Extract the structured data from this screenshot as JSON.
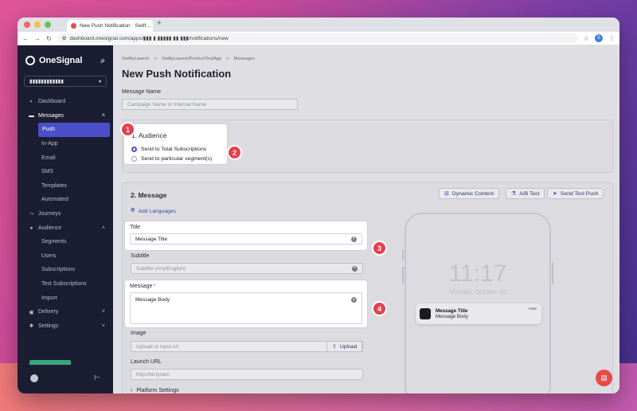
{
  "browser": {
    "tab_title": "New Push Notification · Swift…",
    "tab_close": "×",
    "new_tab": "+",
    "url": "dashboard.onesignal.com/apps/▮▮▮ ▮ ▮▮▮▮▮ ▮▮ ▮▮▮/notifications/new",
    "profile_initial": "S"
  },
  "sidebar": {
    "brand": "OneSignal",
    "app_selector": "▮▮▮▮▮▮▮▮▮▮▮▮",
    "items": [
      {
        "label": "Dashboard",
        "icon": "dashboard-icon"
      },
      {
        "label": "Messages",
        "icon": "messages-icon"
      },
      {
        "label": "Push"
      },
      {
        "label": "In-App"
      },
      {
        "label": "Email"
      },
      {
        "label": "SMS"
      },
      {
        "label": "Templates"
      },
      {
        "label": "Automated"
      },
      {
        "label": "Journeys",
        "icon": "journeys-icon"
      },
      {
        "label": "Audience",
        "icon": "audience-icon"
      },
      {
        "label": "Segments"
      },
      {
        "label": "Users"
      },
      {
        "label": "Subscriptions"
      },
      {
        "label": "Test Subscriptions"
      },
      {
        "label": "Import"
      },
      {
        "label": "Delivery",
        "icon": "delivery-icon"
      },
      {
        "label": "Settings",
        "icon": "settings-icon"
      }
    ]
  },
  "breadcrumb": [
    "SwiftyLaunch",
    "SwiftyLaunchProductTestApp",
    "Messages"
  ],
  "breadcrumb_sep": ">",
  "page_title": "New Push Notification",
  "message_name": {
    "label": "Message Name",
    "placeholder": "Campaign Name or Internal Name"
  },
  "audience": {
    "title": "1. Audience",
    "options": [
      "Send to Total Subscriptions",
      "Send to particular segment(s)"
    ],
    "selected_index": 0
  },
  "message": {
    "title": "2. Message",
    "buttons": {
      "dynamic_content": "Dynamic Content",
      "ab_test": "A/B Test",
      "send_test_push": "Send Test Push"
    },
    "add_languages": "Add Languages",
    "title_field": {
      "label": "Title",
      "value": "Message Title"
    },
    "subtitle_field": {
      "label": "Subtitle",
      "placeholder": "Subtitle (Any/English)"
    },
    "message_field": {
      "label": "Message",
      "required_mark": "*",
      "value": "Message Body"
    },
    "image_field": {
      "label": "Image",
      "placeholder": "Upload or input url",
      "upload_label": "Upload"
    },
    "launch_url_field": {
      "label": "Launch URL",
      "placeholder": "http://bit.ly/abc"
    },
    "platform_settings": "Platform Settings"
  },
  "preview": {
    "time": "11:17",
    "date": "Monday, October 10",
    "notif_title": "Message Title",
    "notif_body": "Message Body",
    "notif_time": "now"
  },
  "callouts": [
    "1",
    "2",
    "3",
    "4"
  ],
  "colors": {
    "accent": "#4b4fc9",
    "brand_red": "#e5404e",
    "sidebar_bg": "#1b1e33"
  }
}
